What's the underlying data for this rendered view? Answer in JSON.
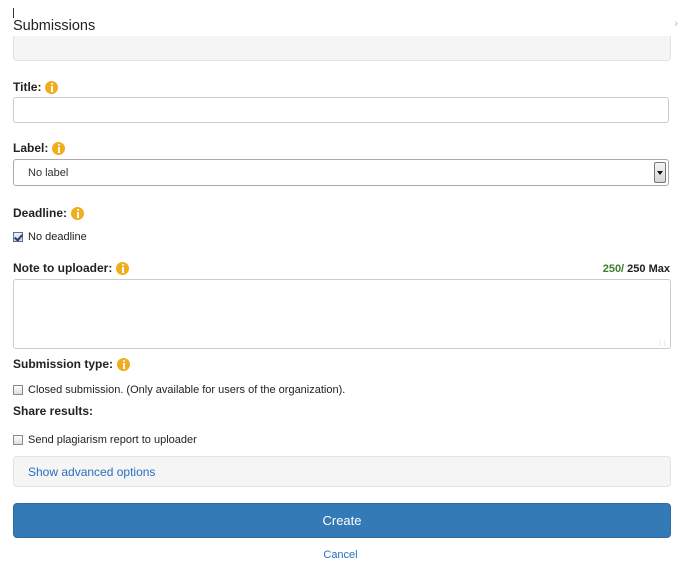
{
  "header": {
    "title": "Submissions"
  },
  "form": {
    "title": {
      "label": "Title:",
      "value": "",
      "placeholder": ""
    },
    "label_field": {
      "label": "Label:",
      "selected": "No label"
    },
    "deadline": {
      "label": "Deadline:",
      "checkbox_label": "No deadline",
      "checked": true
    },
    "note": {
      "label": "Note to uploader:",
      "counter_current": "250/",
      "counter_max": " 250 Max",
      "value": ""
    },
    "submission_type": {
      "label": "Submission type:",
      "checkbox_label": "Closed submission. (Only available for users of the organization).",
      "checked": false
    },
    "share_results": {
      "label": "Share results:",
      "checkbox_label": "Send plagiarism report to uploader",
      "checked": false
    },
    "advanced_link": "Show advanced options",
    "create_label": "Create",
    "cancel_label": "Cancel"
  },
  "colors": {
    "primary": "#337ab7",
    "link": "#2a6ebb",
    "info_icon": "#f0ad1e",
    "counter_ok": "#3a7d2c"
  },
  "icons": [
    "info-icon",
    "chevron-down-icon",
    "checkbox-checked-icon",
    "checkbox-empty-icon"
  ]
}
